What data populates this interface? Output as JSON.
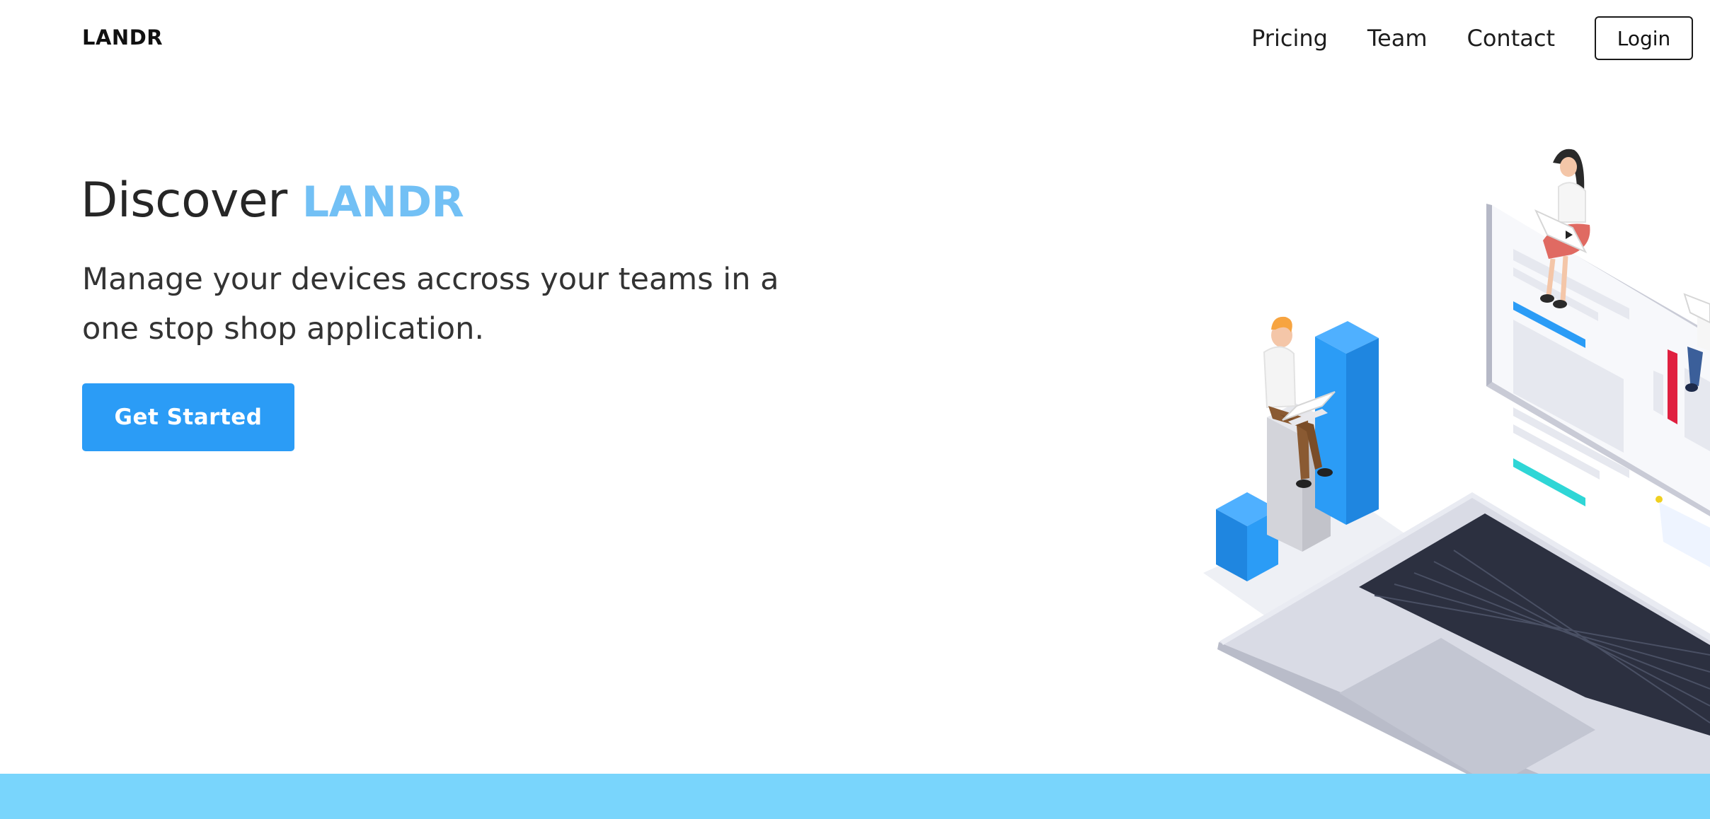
{
  "header": {
    "logo": "LANDR",
    "nav": [
      {
        "label": "Pricing"
      },
      {
        "label": "Team"
      },
      {
        "label": "Contact"
      }
    ],
    "login_label": "Login"
  },
  "hero": {
    "title_prefix": "Discover",
    "title_brand": "LANDR",
    "subtitle": "Manage your devices accross your teams in a one stop shop application.",
    "cta_label": "Get Started"
  },
  "colors": {
    "accent": "#2b9cf6",
    "brand_text": "#72c0f5",
    "bottom_band": "#79d5fc"
  },
  "illustration": {
    "icon": "laptop-team-isometric-illustration"
  }
}
